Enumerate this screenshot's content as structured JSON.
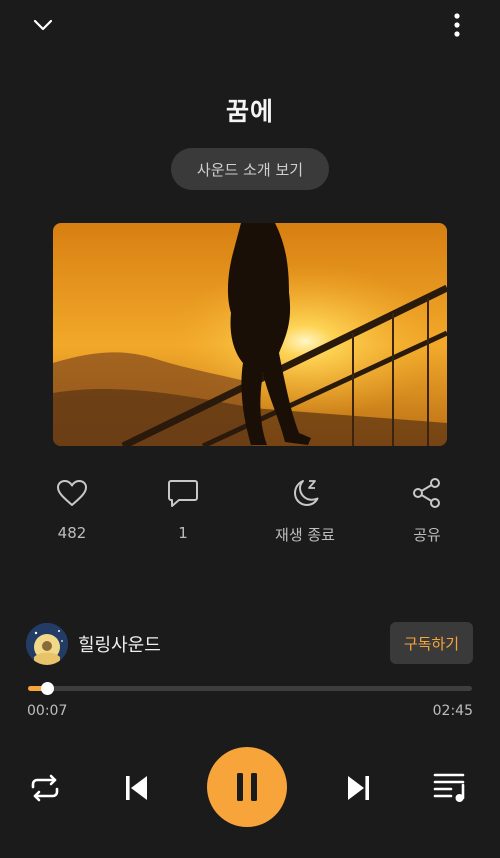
{
  "header": {
    "title": "꿈에",
    "intro_button": "사운드 소개 보기"
  },
  "actions": {
    "like_count": "482",
    "comment_count": "1",
    "sleep_timer_label": "재생 종료",
    "share_label": "공유"
  },
  "channel": {
    "name": "힐링사운드",
    "subscribe_label": "구독하기"
  },
  "player": {
    "elapsed": "00:07",
    "duration": "02:45",
    "progress_fraction": 0.0424
  },
  "colors": {
    "accent": "#f7a43a",
    "background": "#1b1b1b"
  }
}
